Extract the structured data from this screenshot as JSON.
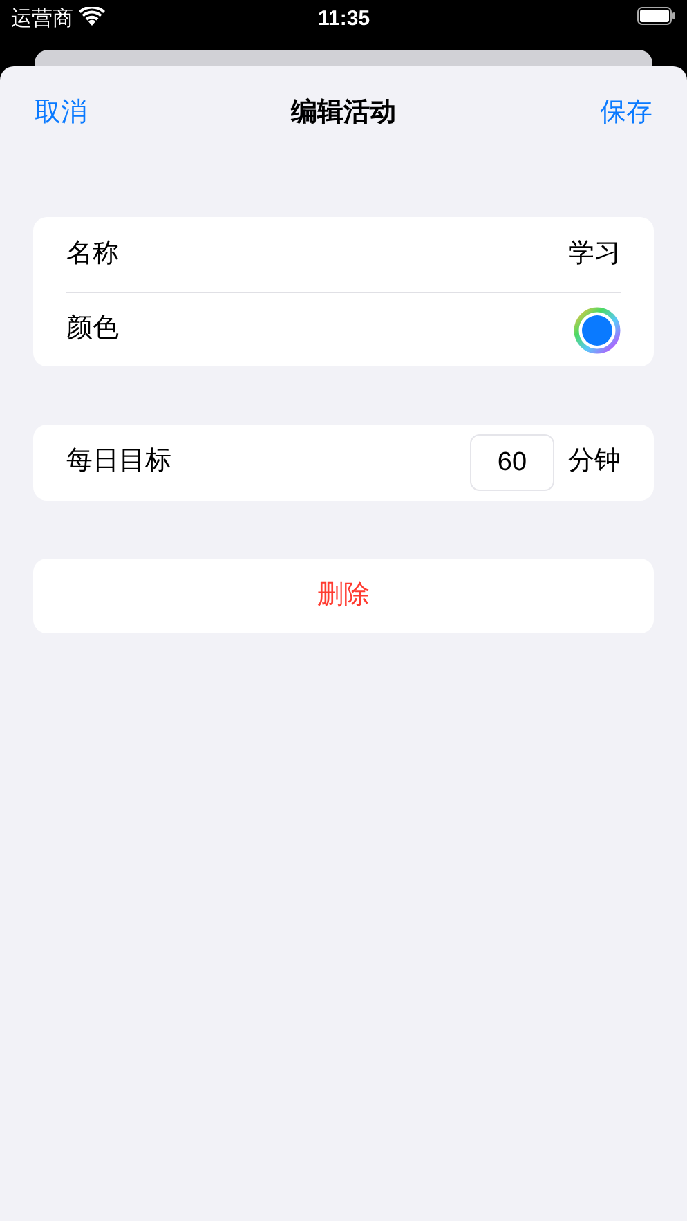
{
  "status_bar": {
    "carrier": "运营商",
    "time": "11:35"
  },
  "nav": {
    "cancel": "取消",
    "title": "编辑活动",
    "save": "保存"
  },
  "details": [
    {
      "kind": "text",
      "label": "名称",
      "value": "学习"
    },
    {
      "kind": "color",
      "label": "颜色",
      "color": "#0a7aff"
    }
  ],
  "goal": {
    "label": "每日目标",
    "value": "60",
    "unit": "分钟"
  },
  "delete_button": "删除"
}
